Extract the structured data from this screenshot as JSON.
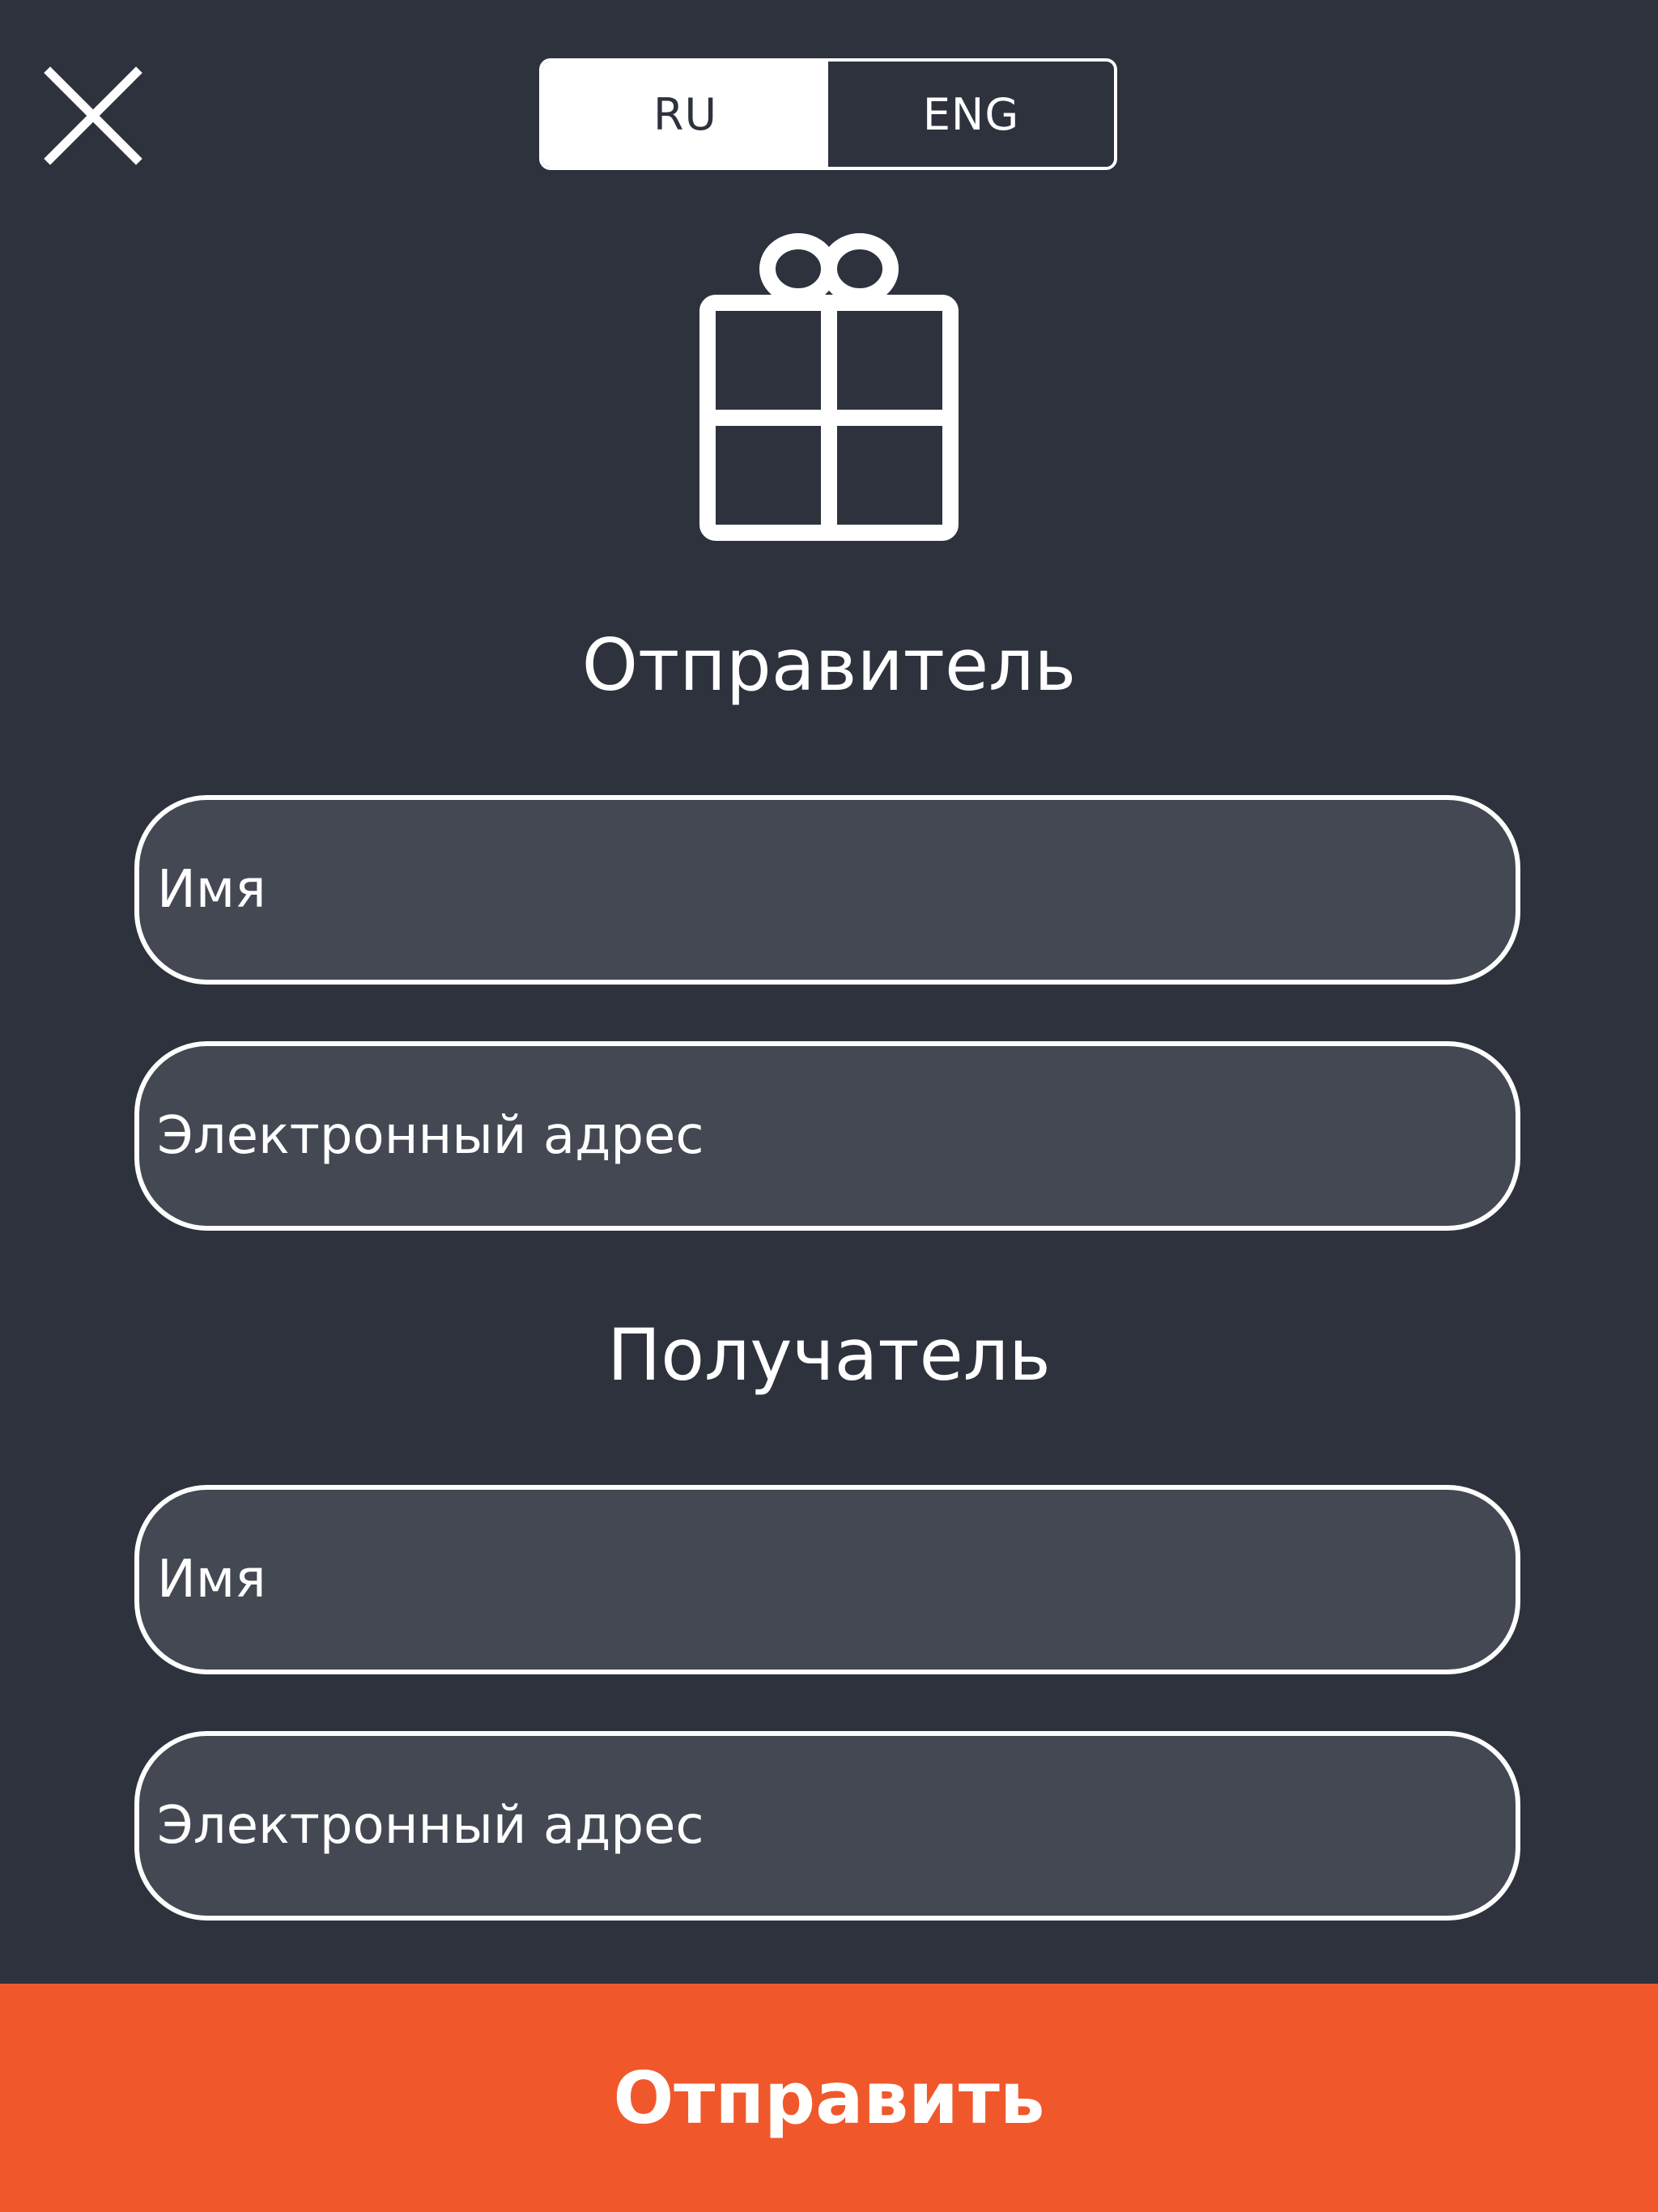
{
  "header": {
    "close_icon": "close-icon",
    "languages": [
      {
        "label": "RU",
        "selected": true
      },
      {
        "label": "ENG",
        "selected": false
      }
    ]
  },
  "gift": {
    "icon": "gift-icon"
  },
  "sender": {
    "title": "Отправитель",
    "name_placeholder": "Имя",
    "email_placeholder": "Электронный адрес"
  },
  "recipient": {
    "title": "Получатель",
    "name_placeholder": "Имя",
    "email_placeholder": "Электронный адрес"
  },
  "submit": {
    "label": "Отправить"
  },
  "colors": {
    "background": "#2e323d",
    "field_background": "#434853",
    "accent": "#f0582b",
    "text": "#ffffff"
  }
}
